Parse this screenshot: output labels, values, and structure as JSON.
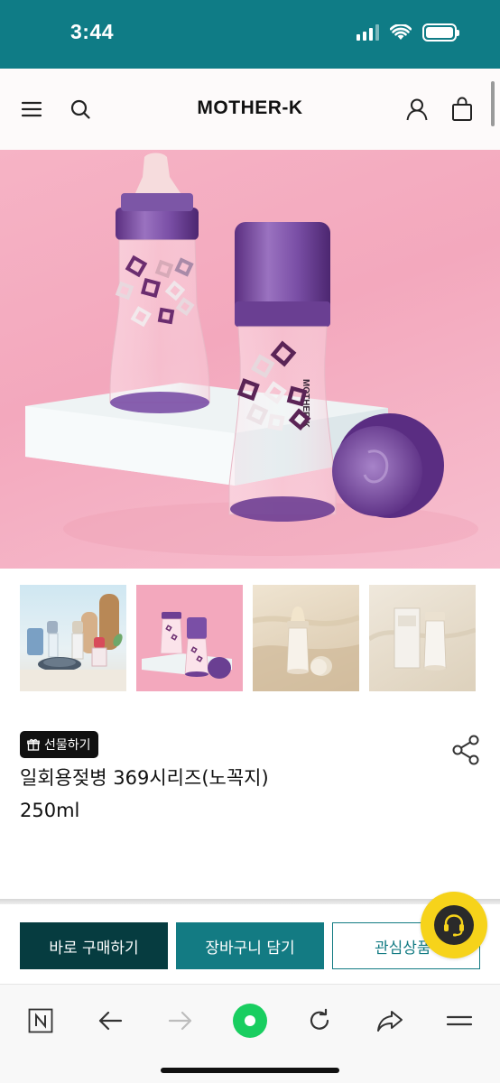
{
  "status_bar": {
    "time": "3:44",
    "icons": [
      "signal-icon",
      "wifi-icon",
      "battery-icon"
    ]
  },
  "header": {
    "brand": "MOTHER-K",
    "icons": [
      "menu-icon",
      "search-icon",
      "user-icon",
      "shopping-bag-icon"
    ]
  },
  "hero": {
    "bottle_print": "MOTHER-K",
    "colors": {
      "background": "#f3a8bd",
      "cap": "#6e3f93"
    }
  },
  "thumbnails": [
    {
      "name": "thumb-lifestyle-kitchen"
    },
    {
      "name": "thumb-pink-bottles"
    },
    {
      "name": "thumb-beige-bottle-cap"
    },
    {
      "name": "thumb-beige-bottle-box"
    }
  ],
  "product": {
    "gift_label": "선물하기",
    "title_line1": "일회용젖병 369시리즈(노꼭지)",
    "title_line2": "250ml"
  },
  "actions": {
    "buy_now": "바로 구매하기",
    "add_to_cart": "장바구니 담기",
    "wishlist": "관심상품"
  },
  "browser_toolbar": {
    "icons": [
      "naver-n-icon",
      "back-arrow-icon",
      "forward-arrow-icon",
      "home-green-dot-icon",
      "refresh-icon",
      "share-arrow-icon",
      "menu-lines-icon"
    ]
  },
  "colors": {
    "teal": "#0f7c86",
    "dark_teal": "#063c40",
    "cart_teal": "#137b83",
    "chat_yellow": "#f6d31a"
  }
}
